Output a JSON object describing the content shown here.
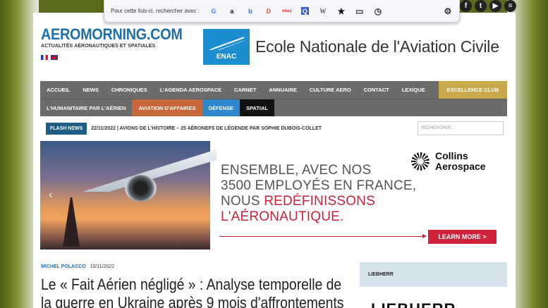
{
  "browser_popup": {
    "label": "Pour cette fois-ci, rechercher avec :",
    "engines": [
      "G",
      "a",
      "b",
      "D",
      "ebay",
      "Q",
      "W",
      "★",
      "▭",
      "◷"
    ],
    "settings_icon": "gear-icon"
  },
  "social": [
    "f",
    "t",
    "▶",
    "≡"
  ],
  "site": {
    "logo": "AEROMORNING.COM",
    "tagline": "ACTUALITÉS AÉRONAUTIQUES ET SPATIALES"
  },
  "ad_top": {
    "badge": "ENAC",
    "text": "Ecole Nationale de l'Aviation Civile"
  },
  "nav": {
    "row1": [
      "ACCUEIL",
      "NEWS",
      "CHRONIQUES",
      "L'AGENDA AEROSPACE",
      "CARNET",
      "ANNUAIRE",
      "CULTURE AERO",
      "CONTACT",
      "LEXIQUE"
    ],
    "excellence": "EXCELLENCE CLUB",
    "row2": [
      "L'HUMANITAIRE PAR L'AÉRIEN",
      "AVIATION D'AFFAIRES",
      "DÉFENSE",
      "SPATIAL"
    ]
  },
  "flash": {
    "badge": "FLASH NEWS",
    "text": "22/11/2022 | AVIONS DE L'HISTOIRE – 25 AÉRONEFS DE LÉGENDE PAR SOPHIE DUBOIS-COLLET",
    "search_placeholder": "RECHERCHER..."
  },
  "banner": {
    "line1": "ENSEMBLE, AVEC NOS",
    "line2": "3500 EMPLOYÉS EN FRANCE,",
    "line3a": "NOUS ",
    "line3b": "REDÉFINISSONS",
    "line4": "L'AÉRONAUTIQUE.",
    "brand1": "Collins",
    "brand2": "Aerospace",
    "cta": "LEARN MORE  >"
  },
  "article": {
    "author": "MICHEL POLACCO",
    "date": "10/11/2022",
    "title": "Le « Fait Aérien négligé » : Analyse temporelle de la guerre en Ukraine après 9 mois d'affrontements"
  },
  "sidebar": {
    "heading": "LIEBHERR",
    "logo": "LIEBHERR"
  },
  "colors": {
    "brand": "#1e6fae",
    "accent_red": "#d0213b",
    "nav": "#6b6b6b"
  }
}
